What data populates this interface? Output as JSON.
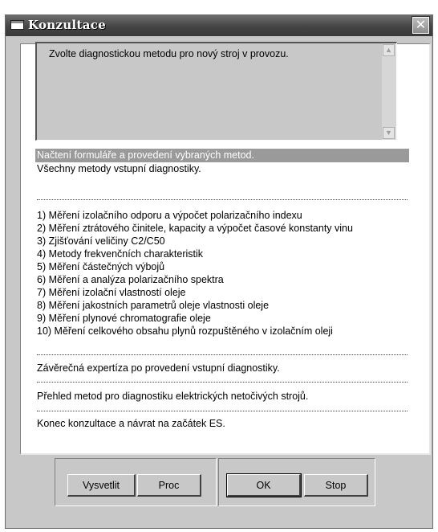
{
  "window": {
    "title": "Konzultace",
    "close_label": "✕"
  },
  "question": {
    "text": "Zvolte diagnostickou metodu pro nový stroj v provozu."
  },
  "list": {
    "selected_index": 0,
    "options": [
      "Načtení formuláře a provedení vybraných metod.",
      "Všechny metody vstupní diagnostiky.",
      "1) Měření izolačního odporu a výpočet polarizačního indexu",
      "2) Měření ztrátového činitele, kapacity a výpočet časové konstanty vinu",
      "3) Zjišťování veličiny C2/C50",
      "4) Metody frekvenčních charakteristik",
      "5) Měření částečných výbojů",
      "6) Měření a analýza polarizačního spektra",
      "7) Měření izolační vlastností oleje",
      "8) Měření jakostních parametrů oleje vlastnosti oleje",
      "9) Měření plynové chromatografie oleje",
      "10) Měření celkového obsahu plynů rozpuštěného v izolačním oleji",
      "Závěrečná expertíza po provedení vstupní diagnostiky.",
      "Přehled metod pro diagnostiku elektrických netočivých strojů.",
      "Konec konzultace a návrat na začátek ES."
    ]
  },
  "buttons": {
    "explain": "Vysvetlit",
    "why": "Proc",
    "ok": "OK",
    "stop": "Stop"
  },
  "icons": {
    "scroll_up": "▲",
    "scroll_down": "▼"
  }
}
